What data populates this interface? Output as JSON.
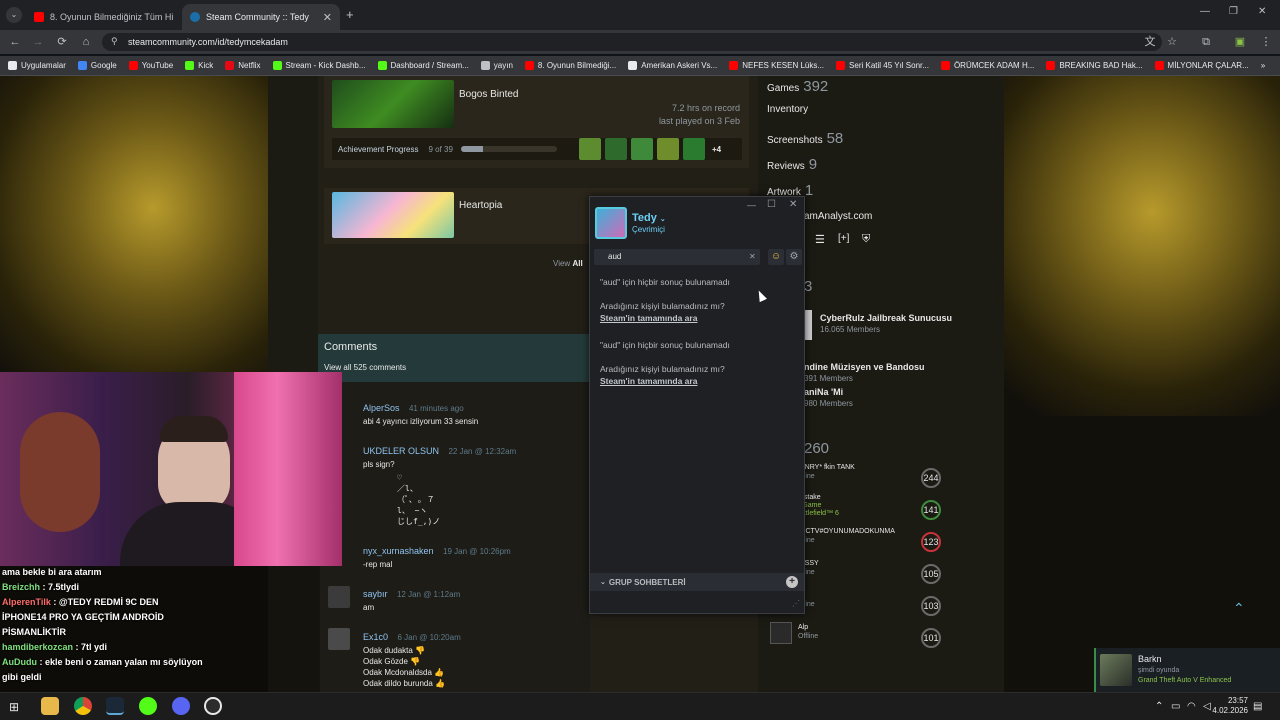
{
  "browser": {
    "tabs": [
      {
        "title": "8. Oyunun Bilmediğiniz Tüm Hi",
        "active": false,
        "icon": "youtube-icon"
      },
      {
        "title": "Steam Community :: Tedy",
        "active": true,
        "icon": "steam-icon"
      }
    ],
    "url": "steamcommunity.com/id/tedymcekadam",
    "bookmarks": [
      {
        "label": "Uygulamalar",
        "icon": "apps-grid-icon",
        "color": "#e8eaed"
      },
      {
        "label": "Google",
        "icon": "google-icon",
        "color": "#4285f4"
      },
      {
        "label": "YouTube",
        "icon": "youtube-icon",
        "color": "#ff0000"
      },
      {
        "label": "Kick",
        "icon": "kick-icon",
        "color": "#53fc18"
      },
      {
        "label": "Netflix",
        "icon": "netflix-icon",
        "color": "#e50914"
      },
      {
        "label": "Stream - Kick Dashb...",
        "icon": "kick-icon",
        "color": "#53fc18"
      },
      {
        "label": "Dashboard / Stream...",
        "icon": "dashboard-icon",
        "color": "#53fc18"
      },
      {
        "label": "yayın",
        "icon": "folder-icon",
        "color": "#bdc1c6"
      },
      {
        "label": "8. Oyunun Bilmediği...",
        "icon": "youtube-icon",
        "color": "#ff0000"
      },
      {
        "label": "Amerikan Askeri Vs...",
        "icon": "globe-icon",
        "color": "#e8eaed"
      },
      {
        "label": "NEFES KESEN Lüks...",
        "icon": "youtube-icon",
        "color": "#ff0000"
      },
      {
        "label": "Seri Katil 45 Yıl Sonr...",
        "icon": "youtube-icon",
        "color": "#ff0000"
      },
      {
        "label": "ÖRÜMCEK ADAM H...",
        "icon": "youtube-icon",
        "color": "#ff0000"
      },
      {
        "label": "BREAKING BAD Hak...",
        "icon": "youtube-icon",
        "color": "#ff0000"
      },
      {
        "label": "MİLYONLAR ÇALAR...",
        "icon": "youtube-icon",
        "color": "#ff0000"
      }
    ]
  },
  "games": [
    {
      "title": "Bogos Binted",
      "hours": "7.2 hrs on record",
      "last_played": "last played on 3 Feb",
      "achievement_label": "Achievement Progress",
      "achievement_count": "9 of 39",
      "achievement_fraction": 0.23,
      "more": "+4"
    },
    {
      "title": "Heartopia"
    }
  ],
  "view_all": {
    "prefix": "View",
    "bold": "All"
  },
  "comments": {
    "title": "Comments",
    "view_all": "View all 525 comments",
    "items": [
      {
        "name": "AlperSos",
        "time": "41 minutes ago",
        "text": "abi 4 yayıncı izliyorum 33 sensin"
      },
      {
        "name": "UKDELER OLSUN",
        "time": "22 Jan @ 12:32am",
        "text": "pls sign?",
        "art": [
          "♡",
          "／l、",
          "（ﾟ､ ｡ ７",
          "l、 ~ヽ",
          "じしf_,)ノ"
        ]
      },
      {
        "name": "nyx_xurnashaken",
        "time": "19 Jan @ 10:26pm",
        "text": "-rep mal"
      },
      {
        "name": "saybır",
        "time": "12 Jan @ 1:12am",
        "text": "am"
      },
      {
        "name": "Ex1c0",
        "time": "6 Jan @ 10:20am",
        "lines": [
          "Odak dudakta 👎",
          "Odak Gözde 👎",
          "Odak Mcdonaldsda 👍",
          "Odak dildo burunda 👍"
        ]
      }
    ]
  },
  "profile_stats": {
    "games": {
      "label": "Games",
      "count": "392"
    },
    "inventory": {
      "label": "Inventory"
    },
    "screenshots": {
      "label": "Screenshots",
      "count": "58"
    },
    "reviews": {
      "label": "Reviews",
      "count": "9"
    },
    "artwork": {
      "label": "Artwork",
      "count": "1"
    },
    "link": "amAnalyst.com",
    "groups_count": "3",
    "groups": [
      {
        "name": "CyberRulz Jailbreak Sunucusu",
        "members": "16.065 Members"
      },
      {
        "name": "ndine Müzisyen ve Bandosu",
        "members": "391 Members"
      },
      {
        "name": "aniNa 'Mi",
        "members": "980 Members"
      }
    ],
    "friends_count": "260",
    "friends": [
      {
        "name": "ENRY* fkin TANK",
        "status": "ffline",
        "level": "244",
        "ring": "#6a6a6a"
      },
      {
        "name": "irstake",
        "status": "-Game",
        "extra": "attlefield™ 6",
        "level": "141",
        "ring": "#3d8c3d"
      },
      {
        "name": "OCTV#OYUNUMADOKUNMA",
        "status": "ffline",
        "level": "123",
        "ring": "#c8323c"
      },
      {
        "name": "ESSY",
        "status": "ffline",
        "level": "105",
        "ring": "#6a6a6a"
      },
      {
        "name": "di",
        "status": "ffline",
        "level": "103",
        "ring": "#6a6a6a"
      },
      {
        "name": "Alp",
        "status": "Offline",
        "level": "101",
        "ring": "#6a6a6a"
      }
    ]
  },
  "friends_popup": {
    "name": "Tedy",
    "status": "Çevrimiçi",
    "search_value": "aud",
    "results": [
      {
        "no_result": "\"aud\" için hiçbir sonuç bulunamadı",
        "prompt": "Aradığınız kişiyi bulamadınız mı?",
        "link": "Steam'in tamamında ara"
      },
      {
        "no_result": "\"aud\" için hiçbir sonuç bulunamadı",
        "prompt": "Aradığınız kişiyi bulamadınız mı?",
        "link": "Steam'in tamamında ara"
      }
    ],
    "group_chats": "GRUP SOHBETLERİ"
  },
  "chat": [
    {
      "user": "",
      "text": "ama bekle bi ara atarım",
      "color": "#ffffff"
    },
    {
      "user": "Breizchh",
      "text": ": 7.5tlydi",
      "color": "#7fe07f"
    },
    {
      "user": "AlperenTilk",
      "text": ": @TEDY REDMİ 9C DEN",
      "color": "#ff6b6b"
    },
    {
      "user": "",
      "text": "İPHONE14 PRO YA GEÇTİM ANDROİD",
      "color": "#ffffff"
    },
    {
      "user": "",
      "text": "PİSMANLİKTİR",
      "color": "#ffffff"
    },
    {
      "user": "hamdiberkozcan",
      "text": ": 7tl ydi",
      "color": "#7fe07f"
    },
    {
      "user": "AuDudu",
      "text": ": ekle beni o zaman yalan mı söylüyon",
      "color": "#7fe07f"
    },
    {
      "user": "",
      "text": "gibi geldi",
      "color": "#ffffff"
    }
  ],
  "notification": {
    "name": "Barkn",
    "status": "şimdi oyunda",
    "game": "Grand Theft Auto V Enhanced"
  },
  "clock": {
    "time": "23:57",
    "date": "4.02.2026"
  }
}
